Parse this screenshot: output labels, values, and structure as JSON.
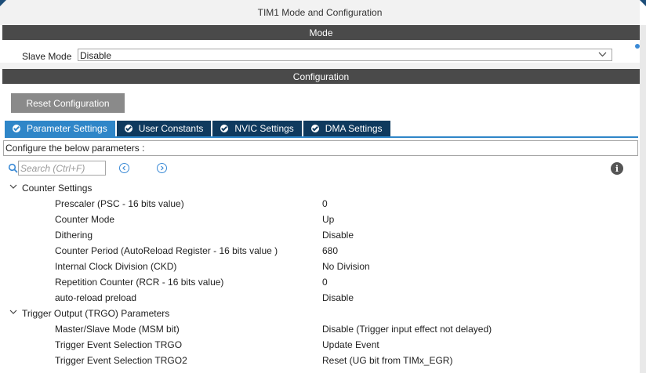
{
  "window": {
    "title": "TIM1 Mode and Configuration"
  },
  "mode_section": {
    "header": "Mode",
    "slave_mode_label": "Slave Mode",
    "slave_mode_value": "Disable"
  },
  "config_section": {
    "header": "Configuration",
    "reset_button": "Reset Configuration",
    "tabs": [
      {
        "label": "Parameter Settings",
        "active": true
      },
      {
        "label": "User Constants",
        "active": false
      },
      {
        "label": "NVIC Settings",
        "active": false
      },
      {
        "label": "DMA Settings",
        "active": false
      }
    ],
    "description": "Configure the below parameters :",
    "search_placeholder": "Search (Ctrl+F)",
    "groups": [
      {
        "name": "Counter Settings",
        "params": [
          {
            "name": "Prescaler (PSC - 16 bits value)",
            "value": "0"
          },
          {
            "name": "Counter Mode",
            "value": "Up"
          },
          {
            "name": "Dithering",
            "value": "Disable"
          },
          {
            "name": "Counter Period (AutoReload Register - 16 bits value )",
            "value": "680"
          },
          {
            "name": "Internal Clock Division (CKD)",
            "value": "No Division"
          },
          {
            "name": "Repetition Counter (RCR - 16 bits value)",
            "value": "0"
          },
          {
            "name": "auto-reload preload",
            "value": "Disable"
          }
        ]
      },
      {
        "name": "Trigger Output (TRGO) Parameters",
        "params": [
          {
            "name": "Master/Slave Mode (MSM bit)",
            "value": "Disable (Trigger input effect not delayed)"
          },
          {
            "name": "Trigger Event Selection TRGO",
            "value": "Update Event"
          },
          {
            "name": "Trigger Event Selection TRGO2",
            "value": "Reset (UG bit from TIMx_EGR)"
          }
        ]
      }
    ]
  },
  "colors": {
    "header_bg": "#4a4a4a",
    "tab_active": "#2f86c8",
    "tab_inactive": "#0f3a5e",
    "button_bg": "#8a8a8a"
  },
  "icons": [
    "search-icon",
    "prev-arrow-icon",
    "next-arrow-icon",
    "info-icon",
    "chevron-down-icon",
    "check-circle-icon"
  ]
}
